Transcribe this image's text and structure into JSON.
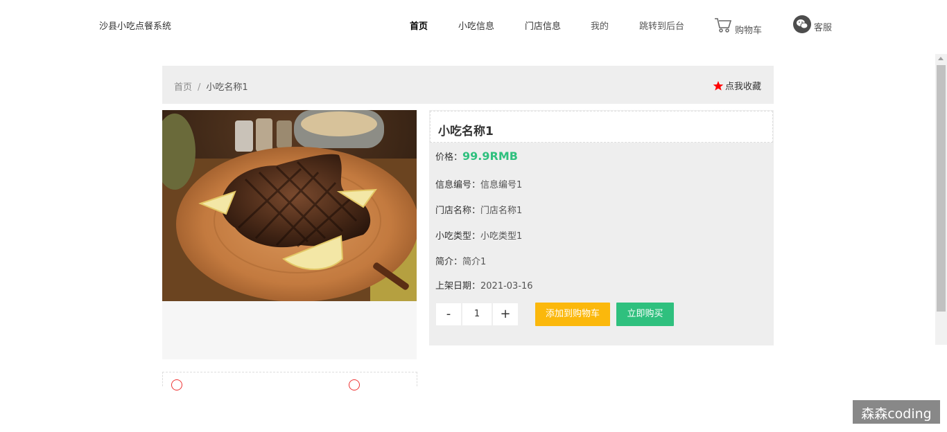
{
  "header": {
    "brand": "沙县小吃点餐系统",
    "nav": [
      {
        "label": "首页"
      },
      {
        "label": "小吃信息"
      },
      {
        "label": "门店信息"
      },
      {
        "label": "我的"
      },
      {
        "label": "跳转到后台"
      }
    ],
    "cart_label": "购物车",
    "service_label": "客服"
  },
  "breadcrumb": {
    "home": "首页",
    "separator": "/",
    "current": "小吃名称1",
    "favorite_label": "点我收藏"
  },
  "product": {
    "title": "小吃名称1",
    "price_label": "价格：",
    "price": "99.9RMB",
    "fields": [
      {
        "label": "信息编号：",
        "value": "信息编号1"
      },
      {
        "label": "门店名称：",
        "value": "门店名称1"
      },
      {
        "label": "小吃类型：",
        "value": "小吃类型1"
      },
      {
        "label": "简介：",
        "value": "简介1"
      },
      {
        "label": "上架日期：",
        "value": "2021-03-16"
      }
    ],
    "quantity": "1",
    "minus": "-",
    "plus": "+",
    "add_to_cart": "添加到购物车",
    "buy_now": "立即购买"
  },
  "watermark": "森森coding",
  "colors": {
    "accent_green": "#2fc07e",
    "accent_yellow": "#fbb80c",
    "favorite_star": "#ff0000"
  }
}
